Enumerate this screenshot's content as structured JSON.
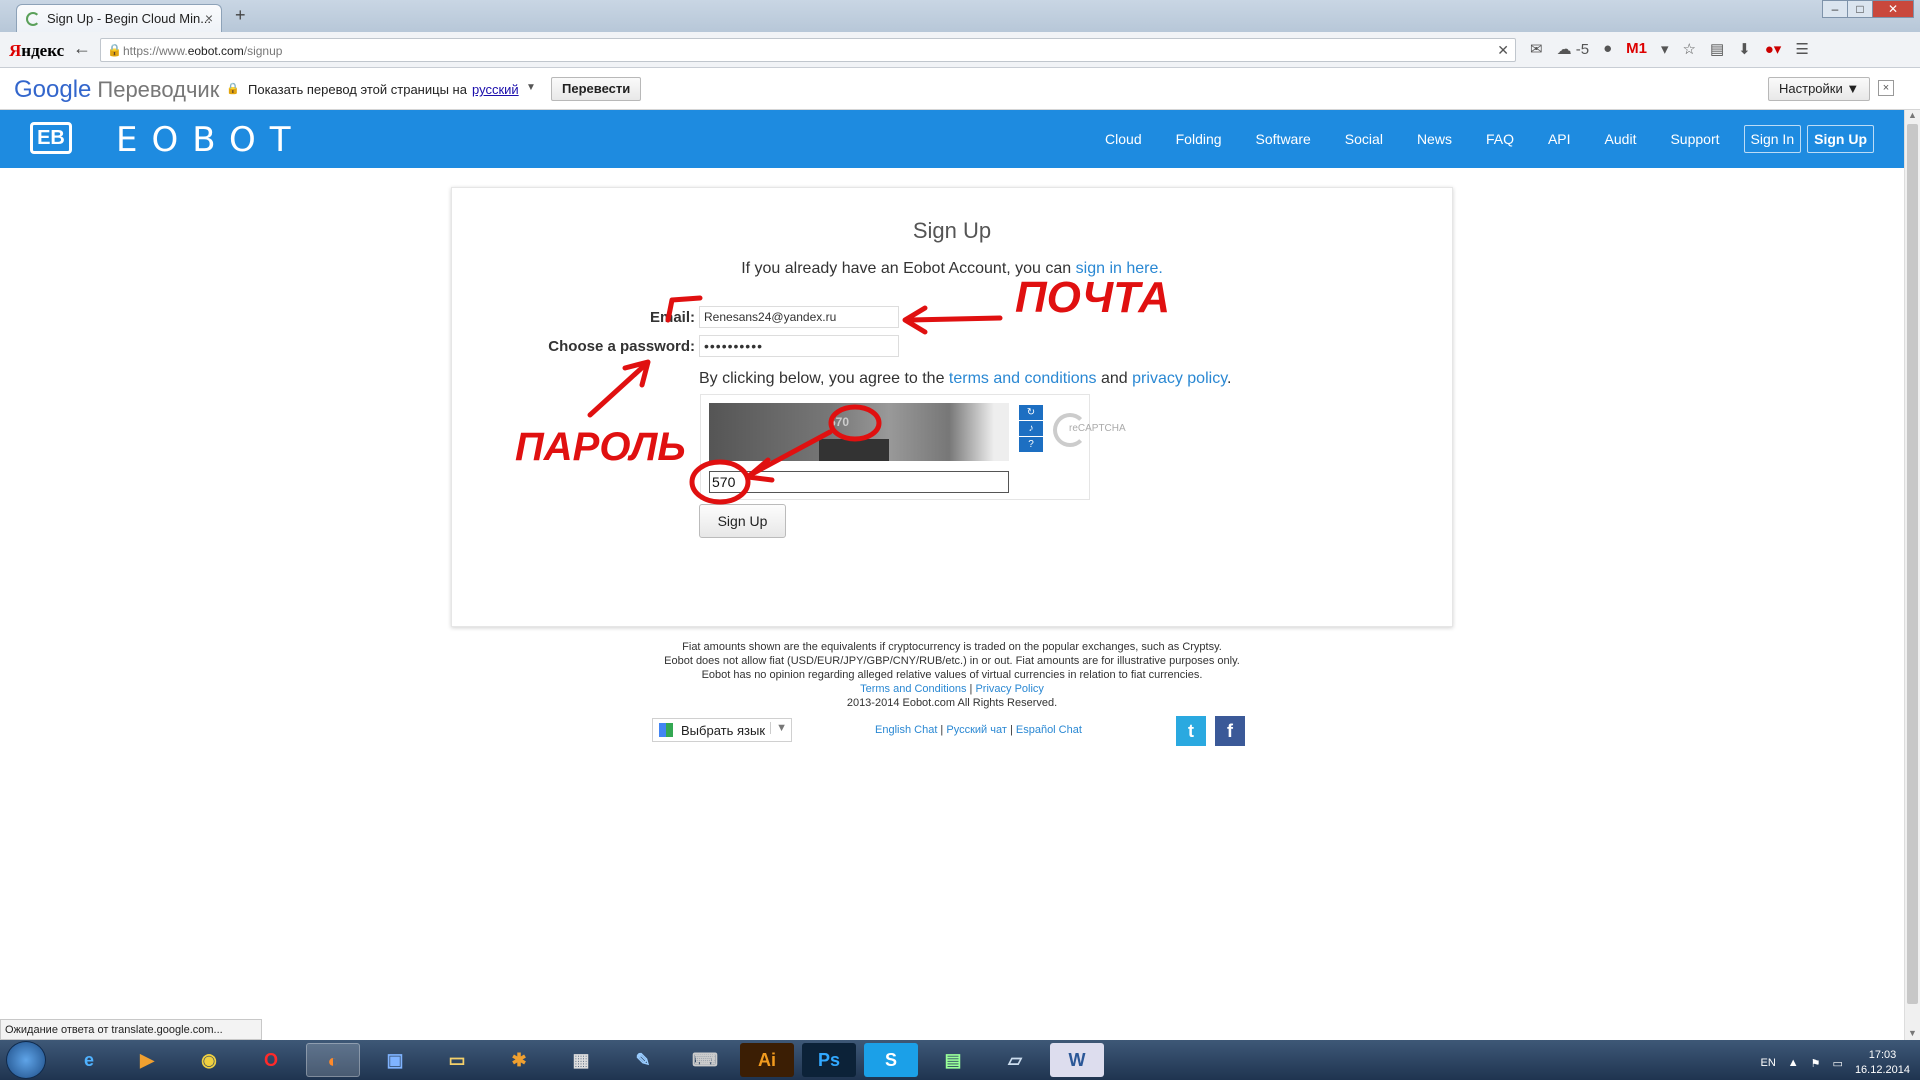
{
  "browser": {
    "tab_title": "Sign Up - Begin Cloud Min...",
    "tab_close": "×",
    "new_tab": "+",
    "url_prefix": "https://www.",
    "url_domain": "eobot.com",
    "url_path": "/signup",
    "yandex_logo_red": "Я",
    "yandex_logo_black": "ндекс",
    "weather": "-5",
    "gmail_label": "M1",
    "status_text": "Ожидание ответа от translate.google.com..."
  },
  "translate_bar": {
    "logo_word": "Google",
    "logo_suffix": "Переводчик",
    "prompt": "Показать перевод этой страницы на",
    "language": "русский",
    "translate_button": "Перевести",
    "settings_button": "Настройки ▼",
    "close": "×"
  },
  "nav": {
    "logo_mark": "EB",
    "logo_text": "EOBOT",
    "links": [
      "Cloud",
      "Folding",
      "Software",
      "Social",
      "News",
      "FAQ",
      "API",
      "Audit",
      "Support"
    ],
    "sign_in": "Sign In",
    "sign_up": "Sign Up"
  },
  "form": {
    "title": "Sign Up",
    "intro_text": "If you already have an Eobot Account, you can ",
    "intro_link": "sign in here.",
    "email_label": "Email:",
    "email_value": "Renesans24@yandex.ru",
    "password_label": "Choose a password:",
    "password_value": "••••••••••",
    "agree_text": "By clicking below, you agree to the ",
    "terms_link": "terms and conditions",
    "and_text": " and ",
    "privacy_link": "privacy policy",
    "period": ".",
    "captcha_image_text": "570",
    "captcha_value": "570",
    "captcha_brand": "reCAPTCHA",
    "submit_button": "Sign Up"
  },
  "footer": {
    "line1": "Fiat amounts shown are the equivalents if cryptocurrency is traded on the popular exchanges, such as Cryptsy.",
    "line2": "Eobot does not allow fiat (USD/EUR/JPY/GBP/CNY/RUB/etc.) in or out. Fiat amounts are for illustrative purposes only.",
    "line3": "Eobot has no opinion regarding alleged relative values of virtual currencies in relation to fiat currencies.",
    "terms": "Terms and Conditions",
    "sep": " | ",
    "privacy": "Privacy Policy",
    "copyright": "2013-2014 Eobot.com All Rights Reserved.",
    "language_select": "Выбрать язык",
    "chat_english": "English Chat",
    "chat_russian": "Русский чат",
    "chat_spanish": "Español Chat"
  },
  "taskbar": {
    "lang": "EN",
    "time": "17:03",
    "date": "16.12.2014",
    "apps": [
      "IE",
      "Media",
      "Chrome",
      "Opera",
      "Firefox",
      "Save",
      "Folder",
      "Tool",
      "Calc",
      "Paint",
      "Net",
      "Ai",
      "Ps",
      "Skype",
      "Grid",
      "Notes",
      "Word"
    ]
  },
  "annotations": {
    "email_note": "ПОЧТА",
    "password_note": "ПАРОЛЬ"
  },
  "colors": {
    "nav_bg": "#1e8be0",
    "link": "#2a88d3",
    "annotation": "#e01010"
  }
}
